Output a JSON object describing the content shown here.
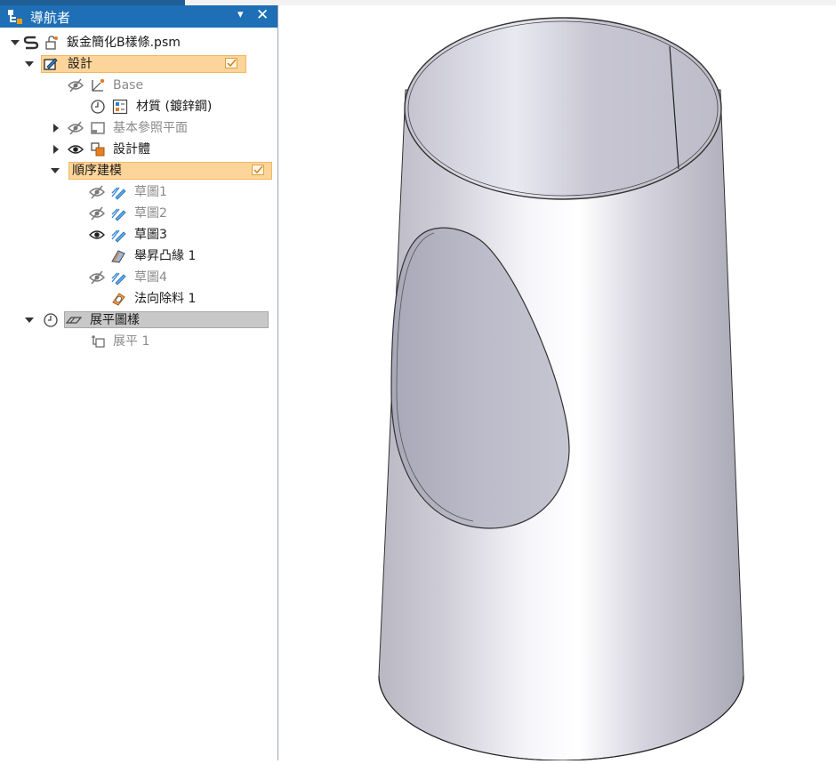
{
  "navigator": {
    "title": "導航者",
    "pin_label": "▾",
    "close_label": "✕"
  },
  "tree": {
    "root": "鈑金簡化B樣條.psm",
    "design": "設計",
    "base": "Base",
    "material": "材質 (鍍鋅鋼)",
    "ref_planes": "基本參照平面",
    "design_body": "設計體",
    "ordered": "順序建模",
    "sketch1": "草圖1",
    "sketch2": "草圖2",
    "sketch3": "草圖3",
    "loft": "舉昇凸緣 1",
    "sketch4": "草圖4",
    "normal_cut": "法向除料 1",
    "flat_pattern": "展平圖樣",
    "flat1": "展平 1"
  },
  "colors": {
    "title_bar": "#1e6fb5",
    "highlight_orange": "#fdd59a",
    "highlight_gray": "#c8c8c8",
    "model_surface": "#c9c8d4"
  },
  "icons": [
    "solid-edge-icon",
    "hide-eye-icon",
    "show-eye-icon",
    "sketch-icon",
    "material-icon",
    "clock-icon",
    "reference-plane-icon",
    "body-icon",
    "contour-flange-icon",
    "cutout-icon",
    "flatten-icon"
  ]
}
